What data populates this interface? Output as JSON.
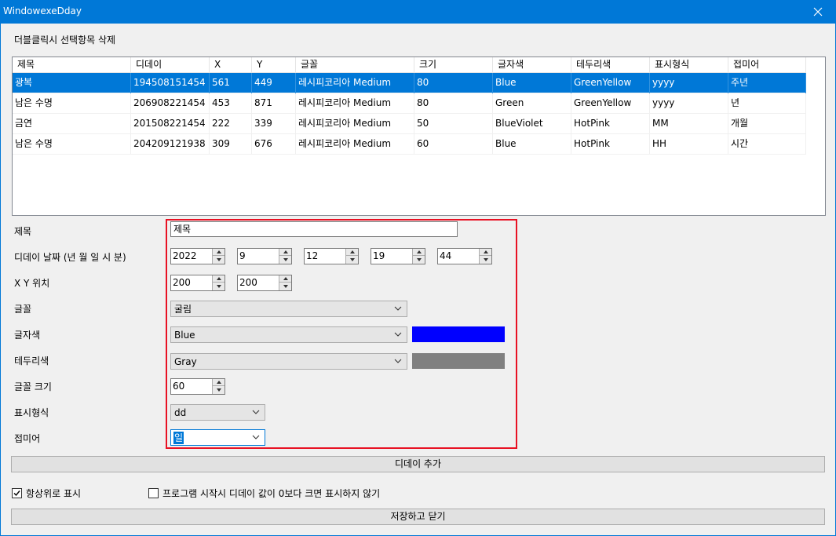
{
  "window": {
    "title": "WindowexeDday",
    "close_icon": "close-icon"
  },
  "hint": "더블클릭시 선택항목 삭제",
  "table": {
    "columns": [
      "제목",
      "디데이",
      "X",
      "Y",
      "글꼴",
      "크기",
      "글자색",
      "테두리색",
      "표시형식",
      "접미어"
    ],
    "rows": [
      [
        "광복",
        "194508151454",
        "561",
        "449",
        "레시피코리아 Medium",
        "80",
        "Blue",
        "GreenYellow",
        "yyyy",
        "주년"
      ],
      [
        "남은 수명",
        "206908221454",
        "453",
        "871",
        "레시피코리아 Medium",
        "80",
        "Green",
        "GreenYellow",
        "yyyy",
        "년"
      ],
      [
        "금연",
        "201508221454",
        "222",
        "339",
        "레시피코리아 Medium",
        "50",
        "BlueViolet",
        "HotPink",
        "MM",
        "개월"
      ],
      [
        "남은 수명",
        "204209121938",
        "309",
        "676",
        "레시피코리아 Medium",
        "60",
        "Blue",
        "HotPink",
        "HH",
        "시간"
      ]
    ],
    "selected_row": 0
  },
  "form": {
    "title_label": "제목",
    "title_value": "제목",
    "date_label": "디데이 날짜 (년 월 일 시 분)",
    "year": "2022",
    "month": "9",
    "day": "12",
    "hour": "19",
    "minute": "44",
    "pos_label": "X Y 위치",
    "x": "200",
    "y": "200",
    "font_label": "글꼴",
    "font_value": "굴림",
    "fore_label": "글자색",
    "fore_value": "Blue",
    "fore_color": "#0000ff",
    "border_label": "테두리색",
    "border_value": "Gray",
    "border_color": "#808080",
    "size_label": "글꼴 크기",
    "size_value": "60",
    "format_label": "표시형식",
    "format_value": "dd",
    "suffix_label": "접미어",
    "suffix_value": "일"
  },
  "buttons": {
    "add": "디데이 추가",
    "save_close": "저장하고 닫기"
  },
  "options": {
    "topmost_label": "항상위로 표시",
    "topmost_checked": true,
    "hide_label": "프로그램 시작시 디데이 값이 0보다 크면 표시하지 않기",
    "hide_checked": false
  },
  "colors": {
    "titlebar": "#0078d7",
    "selection": "#0078d7",
    "highlight_box": "#e81123"
  }
}
